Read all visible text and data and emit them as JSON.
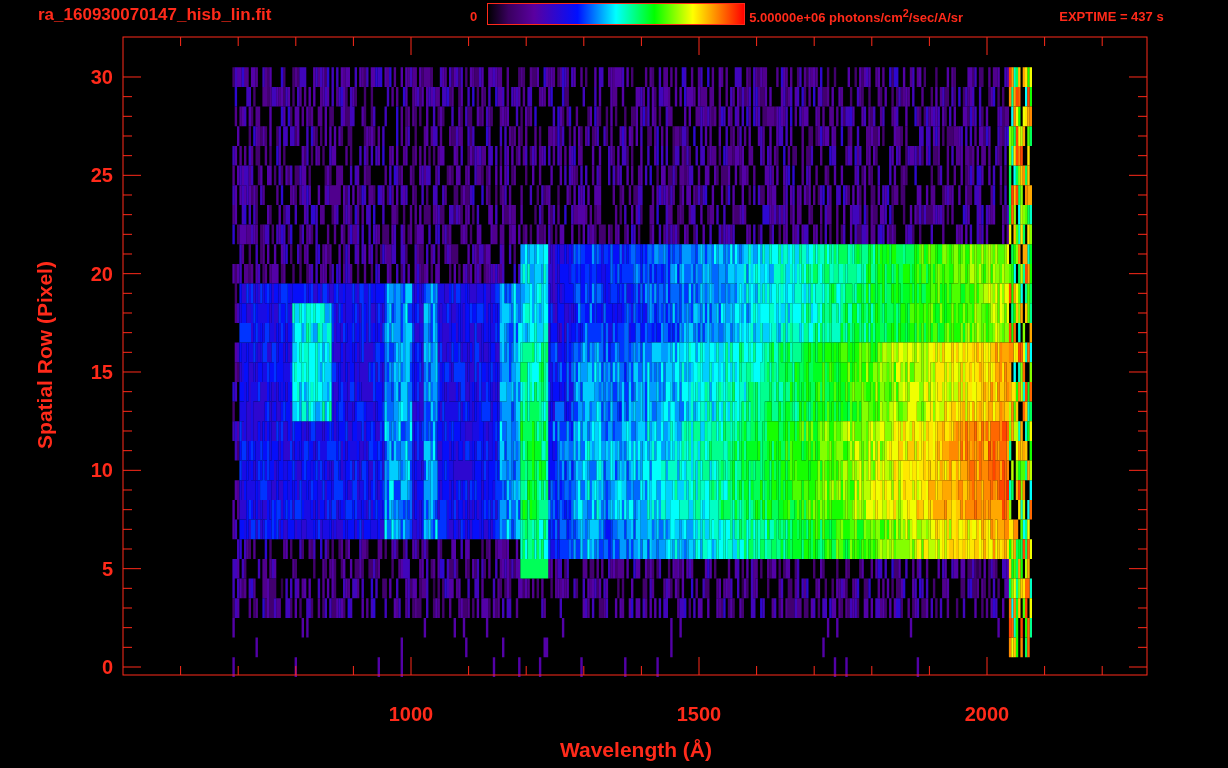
{
  "header": {
    "title": "ra_160930070147_hisb_lin.fit",
    "colorbar": {
      "min_label": "0",
      "max_label": "5.00000e+06 photons/cm$^{2}$/sec/A/sr"
    },
    "exposure": "EXPTIME = 437 s"
  },
  "plot": {
    "xlabel": "Wavelength (Å)",
    "ylabel": "Spatial Row (Pixel)",
    "xticks": [
      "1000",
      "1500",
      "2000"
    ],
    "yticks": [
      "30",
      "25",
      "20",
      "15",
      "10",
      "5",
      "0"
    ]
  }
}
